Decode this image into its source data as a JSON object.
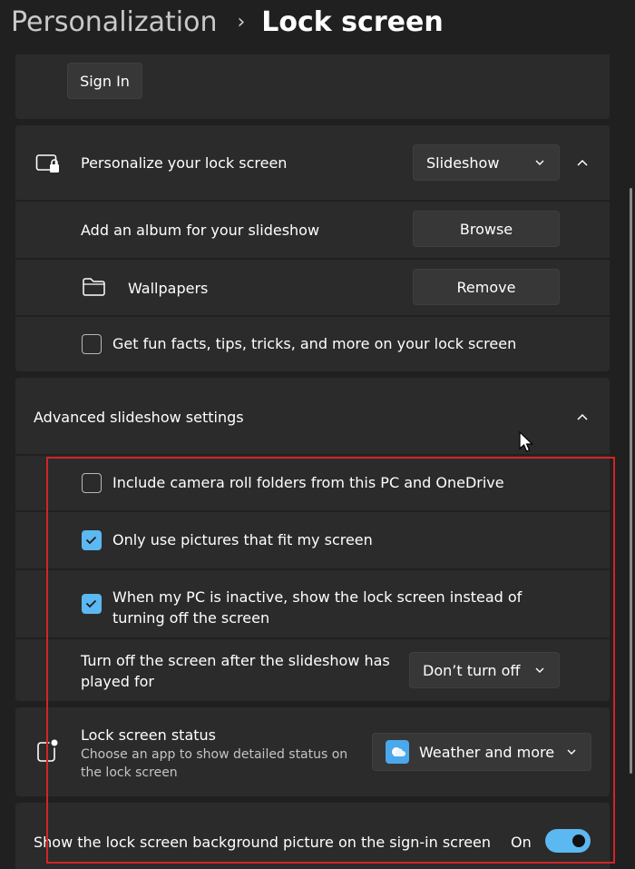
{
  "breadcrumb": {
    "parent": "Personalization",
    "separator": "›",
    "current": "Lock screen"
  },
  "sign_in_button": "Sign In",
  "personalize": {
    "label": "Personalize your lock screen",
    "dropdown_value": "Slideshow",
    "icon": "lock-screen-icon"
  },
  "album": {
    "label": "Add an album for your slideshow",
    "button": "Browse"
  },
  "wallpapers": {
    "label": "Wallpapers",
    "button": "Remove",
    "icon": "folder-icon"
  },
  "fun_facts": {
    "label": "Get fun facts, tips, tricks, and more on your lock screen",
    "checked": false
  },
  "advanced": {
    "label": "Advanced slideshow settings"
  },
  "camera_roll": {
    "label": "Include camera roll folders from this PC and OneDrive",
    "checked": false
  },
  "fit_screen": {
    "label": "Only use pictures that fit my screen",
    "checked": true
  },
  "inactive": {
    "label": "When my PC is inactive, show the lock screen instead of turning off the screen",
    "checked": true
  },
  "turn_off": {
    "label": "Turn off the screen after the slideshow has played for",
    "dropdown_value": "Don’t turn off"
  },
  "status": {
    "label": "Lock screen status",
    "description": "Choose an app to show detailed status on the lock screen",
    "dropdown_value": "Weather and more",
    "icon": "status-dot-icon"
  },
  "signin_bg": {
    "label": "Show the lock screen background picture on the sign-in screen",
    "state": "On"
  },
  "colors": {
    "accent": "#5cb8f0",
    "highlight_box": "#d42424",
    "card": "#2b2b2b",
    "background": "#202020"
  }
}
